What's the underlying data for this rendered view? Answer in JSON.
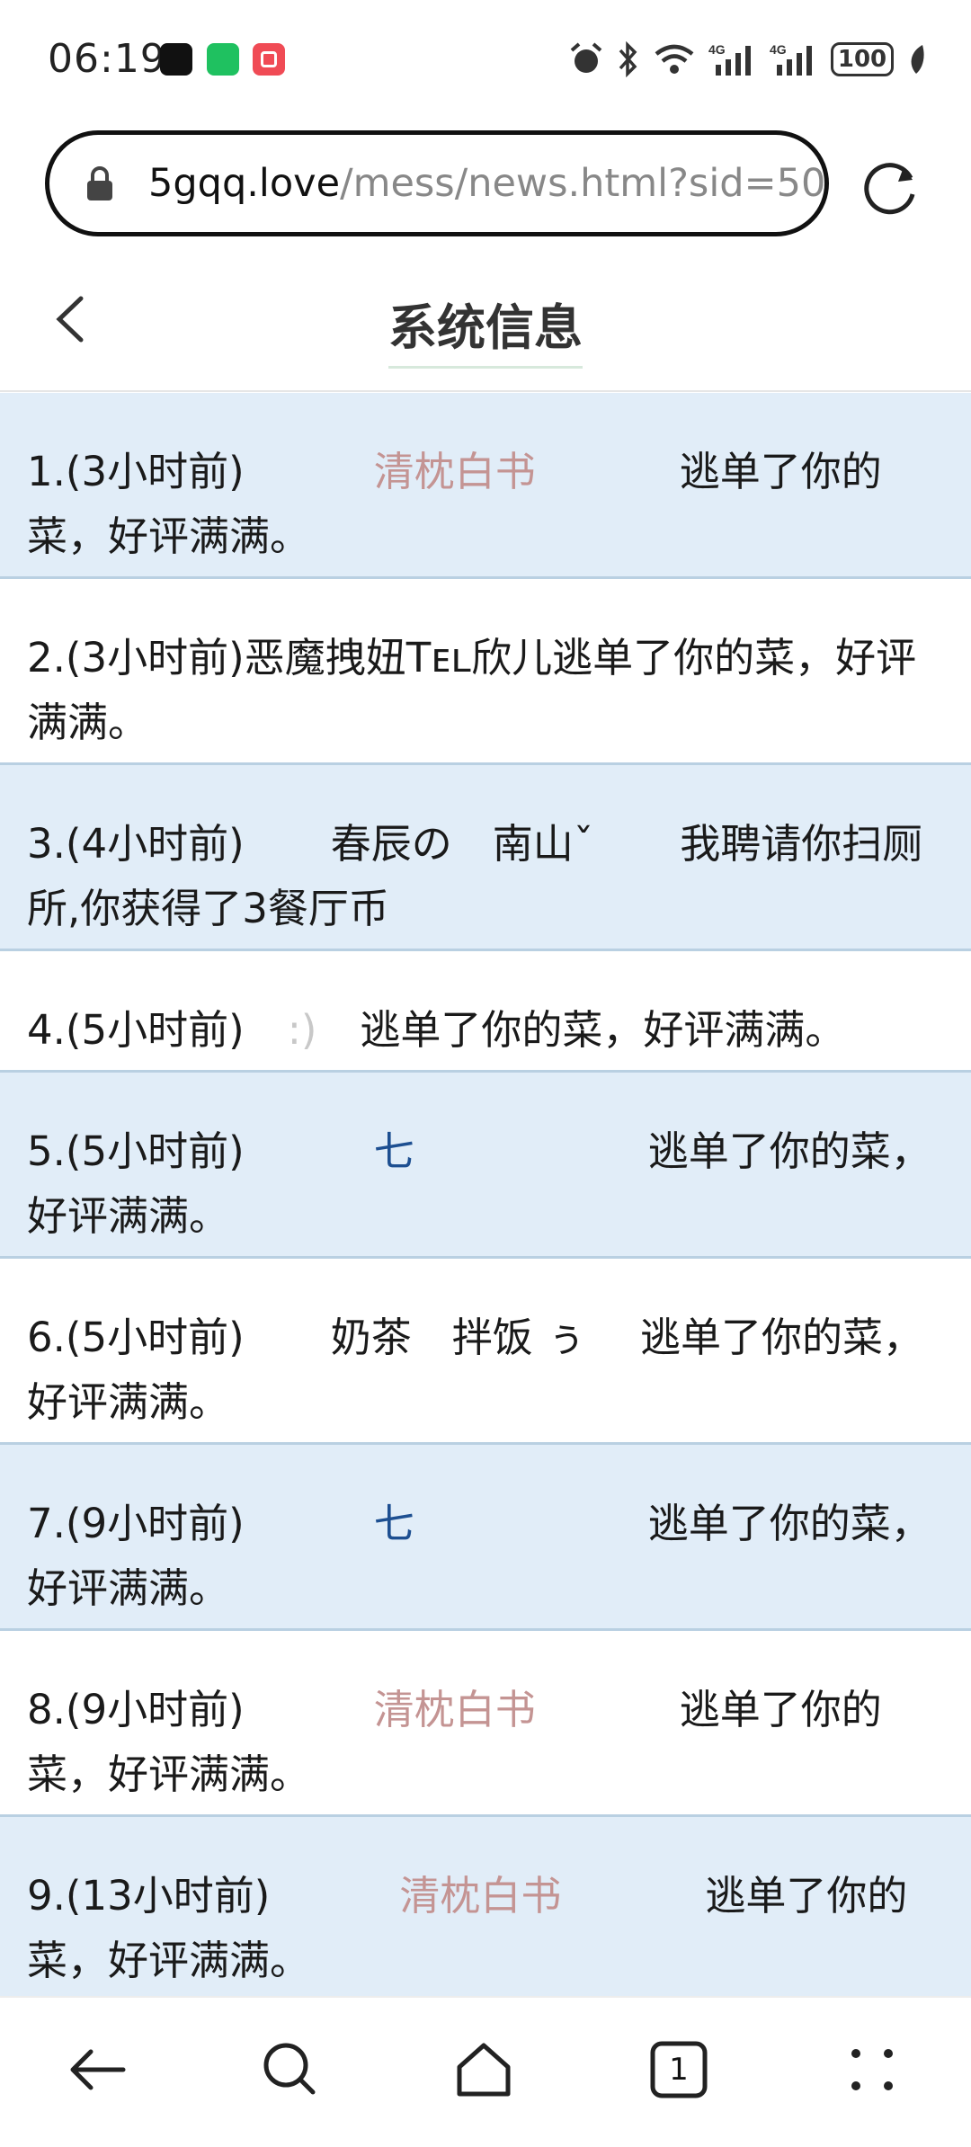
{
  "status": {
    "time": "06:19",
    "battery": "100"
  },
  "browser": {
    "url_host": "5gqq.love",
    "url_path": "/mess/news.html?sid=50",
    "tab_count": "1"
  },
  "page": {
    "title": "系统信息"
  },
  "messages": [
    {
      "prefix": "1.(3小时前)",
      "name": "清枕白书",
      "action": "逃单了你的菜，好评满满。"
    },
    {
      "prefix": "2.(3小时前)",
      "name": "恶魔拽妞Tᴇʟ欣儿",
      "action": "逃单了你的菜，好评满满。"
    },
    {
      "prefix": "3.(4小时前)",
      "name": "春辰の　南山ˇ",
      "action": "我聘请你扫厕所,你获得了3餐厅币"
    },
    {
      "prefix": "4.(5小时前)",
      "name": ":)",
      "action": "逃单了你的菜，好评满满。"
    },
    {
      "prefix": "5.(5小时前)",
      "name": "七",
      "action": "逃单了你的菜，好评满满。"
    },
    {
      "prefix": "6.(5小时前)",
      "name": "奶茶　拌饭 ぅ",
      "action": "逃单了你的菜，好评满满。"
    },
    {
      "prefix": "7.(9小时前)",
      "name": "七",
      "action": "逃单了你的菜，好评满满。"
    },
    {
      "prefix": "8.(9小时前)",
      "name": "清枕白书",
      "action": "逃单了你的菜，好评满满。"
    },
    {
      "prefix": "9.(13小时前)",
      "name": "清枕白书",
      "action": "逃单了你的菜，好评满满。"
    }
  ]
}
